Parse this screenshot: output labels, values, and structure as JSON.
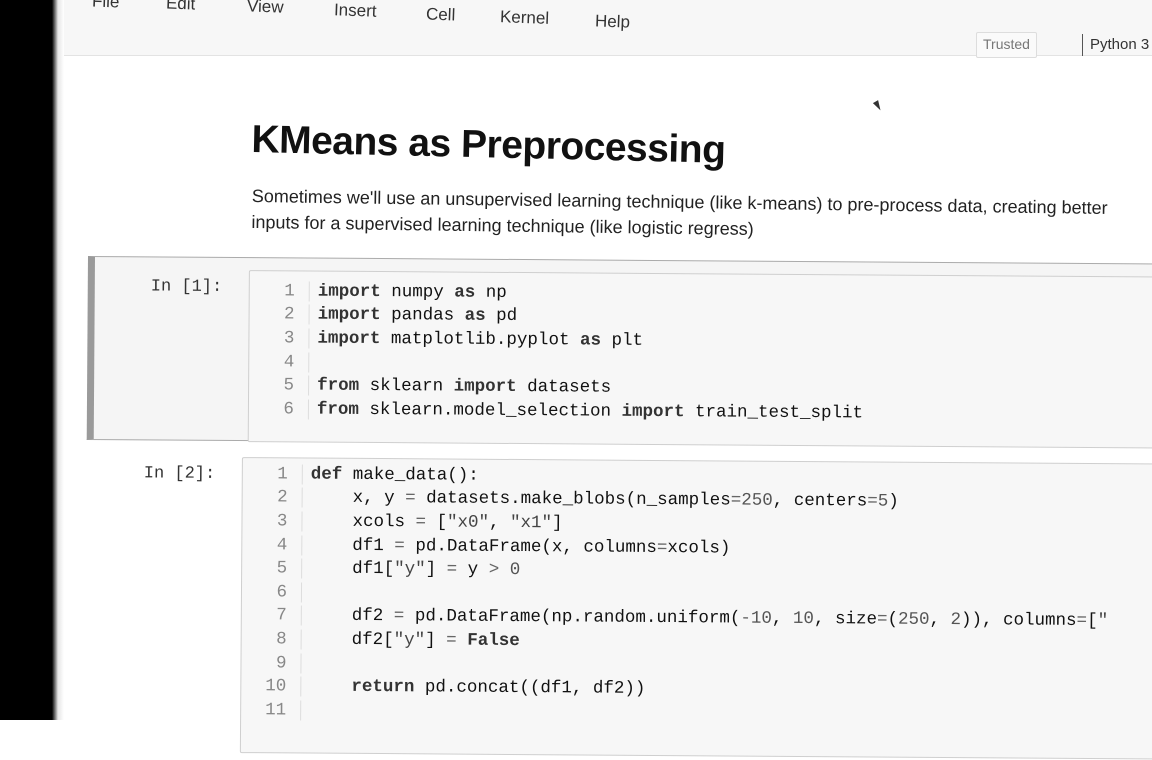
{
  "menu": {
    "items": [
      "File",
      "Edit",
      "View",
      "Insert",
      "Cell",
      "Kernel",
      "Help"
    ]
  },
  "status": {
    "trusted": "Trusted",
    "kernel": "Python 3"
  },
  "notebook": {
    "title": "KMeans as Preprocessing",
    "intro": "Sometimes we'll use an unsupervised learning technique (like k-means) to pre-process data, creating better inputs for a supervised learning technique (like logistic regress)",
    "cells": [
      {
        "prompt": "In [1]:",
        "lines": [
          {
            "n": "1",
            "code": "import numpy as np"
          },
          {
            "n": "2",
            "code": "import pandas as pd"
          },
          {
            "n": "3",
            "code": "import matplotlib.pyplot as plt"
          },
          {
            "n": "4",
            "code": ""
          },
          {
            "n": "5",
            "code": "from sklearn import datasets"
          },
          {
            "n": "6",
            "code": "from sklearn.model_selection import train_test_split"
          }
        ]
      },
      {
        "prompt": "In [2]:",
        "lines": [
          {
            "n": "1",
            "code": "def make_data():"
          },
          {
            "n": "2",
            "code": "    x, y = datasets.make_blobs(n_samples=250, centers=5)"
          },
          {
            "n": "3",
            "code": "    xcols = [\"x0\", \"x1\"]"
          },
          {
            "n": "4",
            "code": "    df1 = pd.DataFrame(x, columns=xcols)"
          },
          {
            "n": "5",
            "code": "    df1[\"y\"] = y > 0"
          },
          {
            "n": "6",
            "code": ""
          },
          {
            "n": "7",
            "code": "    df2 = pd.DataFrame(np.random.uniform(-10, 10, size=(250, 2)), columns=["
          },
          {
            "n": "8",
            "code": "    df2[\"y\"] = False"
          },
          {
            "n": "9",
            "code": ""
          },
          {
            "n": "10",
            "code": "    return pd.concat((df1, df2))"
          },
          {
            "n": "11",
            "code": ""
          }
        ]
      }
    ]
  }
}
